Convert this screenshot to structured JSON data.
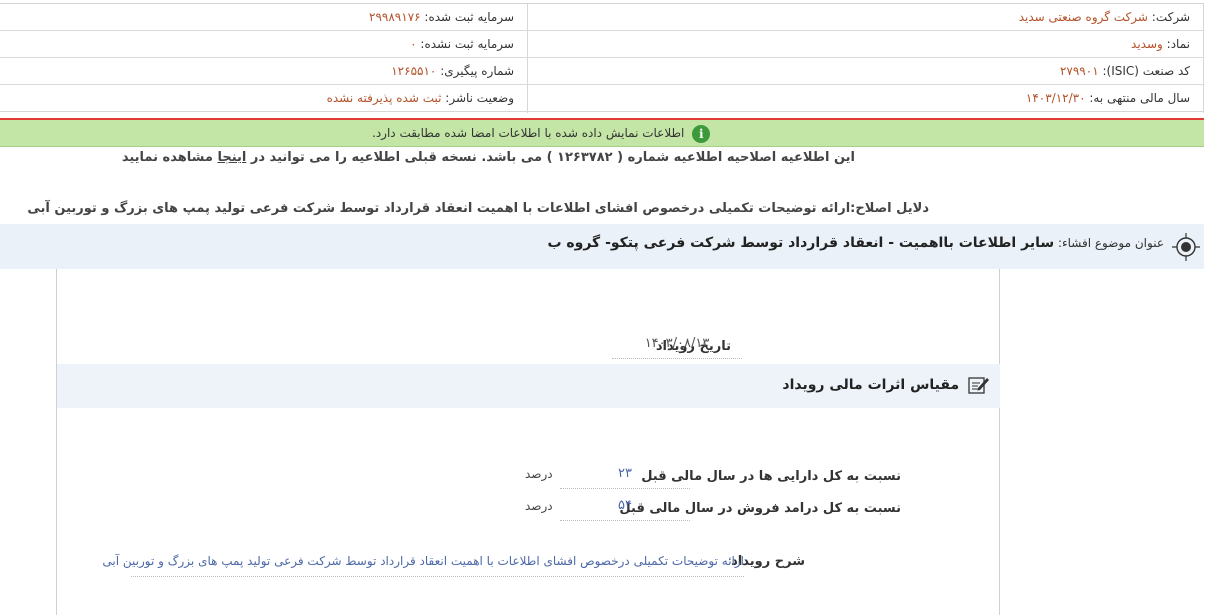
{
  "header": {
    "rows": [
      {
        "right": {
          "label": "شرکت:",
          "value": "شرکت گروه صنعتی سدید"
        },
        "left": {
          "label": "سرمایه ثبت شده:",
          "value": "۲۹۹۸۹۱۷۶"
        }
      },
      {
        "right": {
          "label": "نماد:",
          "value": "وسدید"
        },
        "left": {
          "label": "سرمایه ثبت نشده:",
          "value": "۰"
        }
      },
      {
        "right": {
          "label": "کد صنعت (ISIC):",
          "value": "۲۷۹۹۰۱"
        },
        "left": {
          "label": "شماره پیگیری:",
          "value": "۱۲۶۵۵۱۰"
        }
      },
      {
        "right": {
          "label": "سال مالی منتهی به:",
          "value": "۱۴۰۳/۱۲/۳۰"
        },
        "left": {
          "label": "وضعیت ناشر:",
          "value": "ثبت شده پذیرفته نشده"
        }
      }
    ]
  },
  "notice": {
    "icon": "info-icon",
    "icon_glyph": "i",
    "text": "اطلاعات نمایش داده شده با اطلاعات امضا شده مطابقت دارد.",
    "colors": {
      "background": "#c3e6a6",
      "icon": "#3d9a3a",
      "divider": "#e53935"
    }
  },
  "correction": {
    "line1_before": "این اطلاعیه اصلاحیه اطلاعیه شماره ( ۱۲۶۳۷۸۲ ) می باشد. نسخه قبلی اطلاعیه را می توانید در",
    "link": "اینجا",
    "line1_after": "مشاهده نمایید",
    "line2": "دلایل اصلاح:ارائه توضیحات تکمیلی درخصوص افشای اطلاعات با اهمیت انعقاد قرارداد توسط شرکت فرعی تولید پمپ های بزرگ و توربین آبی"
  },
  "disclosure": {
    "label": "عنوان موضوع افشاء:",
    "title": "سایر اطلاعات بااهمیت - انعقاد قرارداد توسط شرکت فرعی پتکو- گروه ب"
  },
  "event": {
    "date_label": "تاریخ رویداد",
    "date_value": "۱۴۰۳/۰۸/۱۳"
  },
  "financial": {
    "section_title": "مقیاس اثرات مالی رویداد",
    "metrics": [
      {
        "label": "نسبت به کل دارایی ها در سال مالی قبل",
        "value": "۲۳",
        "unit": "درصد"
      },
      {
        "label": "نسبت به کل درامد فروش در سال مالی قبل",
        "value": "۵۴",
        "unit": "درصد"
      }
    ]
  },
  "description": {
    "label": "شرح رویداد",
    "value": "ارائه توضیحات تکمیلی درخصوص افشای اطلاعات با اهمیت انعقاد قرارداد توسط شرکت فرعی تولید پمپ های بزرگ و توربین آبی"
  }
}
